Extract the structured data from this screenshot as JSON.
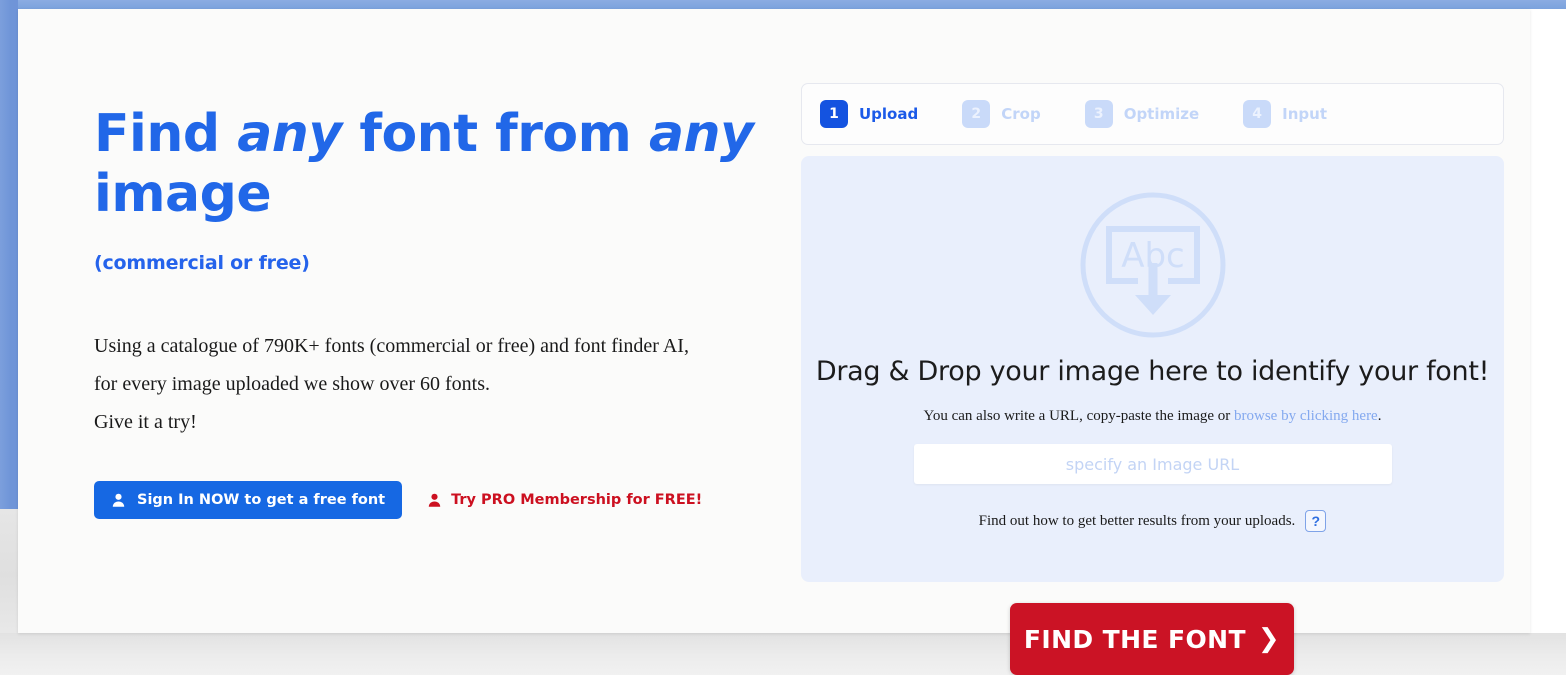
{
  "hero": {
    "headline_part1": "Find ",
    "headline_em1": "any",
    "headline_part2": " font from ",
    "headline_em2": "any",
    "headline_part3": "image",
    "subtitle": "(commercial or free)",
    "body_line1": "Using a catalogue of 790K+ fonts (commercial or free) and font finder AI,",
    "body_line2": "for every image uploaded we show over 60 fonts.",
    "body_line3": "Give it a try!",
    "signin_label": "Sign In NOW to get a free font",
    "pro_label": "Try PRO Membership for FREE!",
    "signin_icon": "person-icon",
    "pro_icon": "person-icon"
  },
  "steps": [
    {
      "number": "1",
      "label": "Upload",
      "state": "active"
    },
    {
      "number": "2",
      "label": "Crop",
      "state": "inactive"
    },
    {
      "number": "3",
      "label": "Optimize",
      "state": "inactive"
    },
    {
      "number": "4",
      "label": "Input",
      "state": "inactive"
    }
  ],
  "dropzone": {
    "icon": "abc-download-icon",
    "title": "Drag & Drop your image here to identify your font!",
    "sub_prefix": "You can also write a URL, copy-paste the image or ",
    "sub_link": "browse by clicking here",
    "sub_suffix": ".",
    "url_placeholder": "specify an Image URL",
    "url_value": "",
    "footer_text": "Find out how to get better results from your uploads.",
    "help_label": "?"
  },
  "find_button": {
    "label": "FIND THE FONT",
    "chevron": "❯"
  },
  "colors": {
    "brand_blue": "#1668e3",
    "headline_blue": "#2167e8",
    "accent_red": "#cb1325",
    "pro_red": "#cc1020",
    "dropzone_bg": "#e9effc"
  }
}
